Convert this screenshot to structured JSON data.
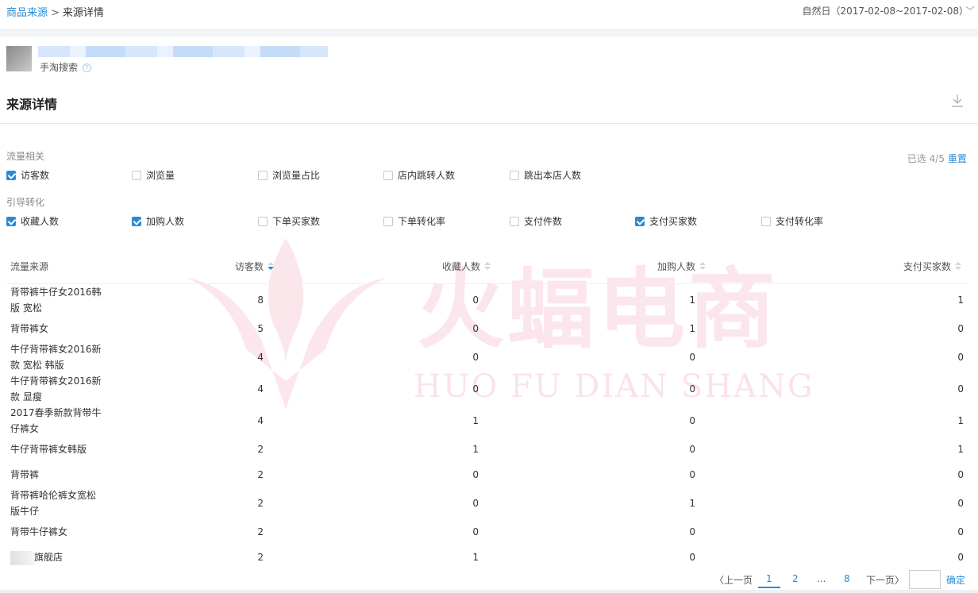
{
  "breadcrumb": {
    "parent": "商品来源",
    "separator": ">",
    "current": "来源详情"
  },
  "date_range": {
    "label": "自然日（2017-02-08~2017-02-08）",
    "chevron": "﹀"
  },
  "product": {
    "source": "手淘搜索",
    "help": "?"
  },
  "section": {
    "title": "来源详情"
  },
  "filters": {
    "selected_text": "已选 4/5",
    "reset_label": "重置",
    "groups": [
      {
        "label": "流量相关",
        "items": [
          {
            "label": "访客数",
            "checked": true
          },
          {
            "label": "浏览量",
            "checked": false
          },
          {
            "label": "浏览量占比",
            "checked": false
          },
          {
            "label": "店内跳转人数",
            "checked": false
          },
          {
            "label": "跳出本店人数",
            "checked": false
          }
        ]
      },
      {
        "label": "引导转化",
        "items": [
          {
            "label": "收藏人数",
            "checked": true
          },
          {
            "label": "加购人数",
            "checked": true
          },
          {
            "label": "下单买家数",
            "checked": false
          },
          {
            "label": "下单转化率",
            "checked": false
          },
          {
            "label": "支付件数",
            "checked": false
          },
          {
            "label": "支付买家数",
            "checked": true
          },
          {
            "label": "支付转化率",
            "checked": false
          }
        ]
      }
    ]
  },
  "table": {
    "columns": [
      "流量来源",
      "访客数",
      "收藏人数",
      "加购人数",
      "支付买家数"
    ],
    "rows": [
      {
        "name": [
          "背带裤牛仔女2016韩",
          "版 宽松"
        ],
        "visitors": "8",
        "favorites": "0",
        "cart": "1",
        "buyers": "1"
      },
      {
        "name": [
          "背带裤女"
        ],
        "visitors": "5",
        "favorites": "0",
        "cart": "1",
        "buyers": "0"
      },
      {
        "name": [
          "牛仔背带裤女2016新",
          "款 宽松 韩版"
        ],
        "visitors": "4",
        "favorites": "0",
        "cart": "0",
        "buyers": "0"
      },
      {
        "name": [
          "牛仔背带裤女2016新",
          "款 显瘦"
        ],
        "visitors": "4",
        "favorites": "0",
        "cart": "0",
        "buyers": "0"
      },
      {
        "name": [
          "2017春季新款背带牛",
          "仔裤女"
        ],
        "visitors": "4",
        "favorites": "1",
        "cart": "0",
        "buyers": "1"
      },
      {
        "name": [
          "牛仔背带裤女韩版"
        ],
        "visitors": "2",
        "favorites": "1",
        "cart": "0",
        "buyers": "1"
      },
      {
        "name": [
          "背带裤"
        ],
        "visitors": "2",
        "favorites": "0",
        "cart": "0",
        "buyers": "0"
      },
      {
        "name": [
          "背带裤哈伦裤女宽松",
          "版牛仔"
        ],
        "visitors": "2",
        "favorites": "0",
        "cart": "1",
        "buyers": "0"
      },
      {
        "name": [
          "背带牛仔裤女"
        ],
        "visitors": "2",
        "favorites": "0",
        "cart": "0",
        "buyers": "0"
      },
      {
        "name": [
          "旗舰店"
        ],
        "visitors": "2",
        "favorites": "1",
        "cart": "0",
        "buyers": "0"
      }
    ]
  },
  "pagination": {
    "prev": "〈上一页",
    "pages": [
      "1",
      "2",
      "...",
      "8"
    ],
    "next": "下一页〉",
    "confirm": "确定"
  },
  "watermark": {
    "text": "火蝠电商",
    "sub": "HUO FU DIAN SHANG"
  },
  "colors": {
    "accent": "#2a8ad4",
    "watermark": "#e66482"
  }
}
